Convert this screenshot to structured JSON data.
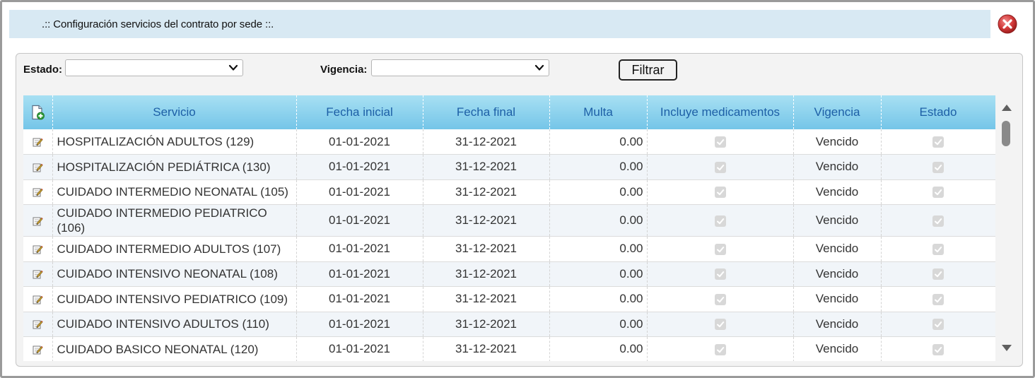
{
  "window": {
    "title": ".:: Configuración servicios del contrato por sede ::.",
    "close_icon": "close-circle-icon",
    "close_color": "#d33a3a"
  },
  "filters": {
    "estado_label": "Estado:",
    "estado_value": "",
    "vigencia_label": "Vigencia:",
    "vigencia_value": "",
    "filter_button": "Filtrar"
  },
  "table": {
    "add_icon": "add-document-icon",
    "columns": [
      "Servicio",
      "Fecha inicial",
      "Fecha final",
      "Multa",
      "Incluye medicamentos",
      "Vigencia",
      "Estado"
    ],
    "row_icon": "edit-icon",
    "rows": [
      {
        "servicio": "HOSPITALIZACIÓN ADULTOS (129)",
        "fecha_inicial": "01-01-2021",
        "fecha_final": "31-12-2021",
        "multa": "0.00",
        "incluye_medicamentos": true,
        "vigencia": "Vencido",
        "estado": true
      },
      {
        "servicio": "HOSPITALIZACIÓN PEDIÁTRICA (130)",
        "fecha_inicial": "01-01-2021",
        "fecha_final": "31-12-2021",
        "multa": "0.00",
        "incluye_medicamentos": true,
        "vigencia": "Vencido",
        "estado": true
      },
      {
        "servicio": "CUIDADO INTERMEDIO NEONATAL (105)",
        "fecha_inicial": "01-01-2021",
        "fecha_final": "31-12-2021",
        "multa": "0.00",
        "incluye_medicamentos": true,
        "vigencia": "Vencido",
        "estado": true
      },
      {
        "servicio": "CUIDADO INTERMEDIO PEDIATRICO (106)",
        "fecha_inicial": "01-01-2021",
        "fecha_final": "31-12-2021",
        "multa": "0.00",
        "incluye_medicamentos": true,
        "vigencia": "Vencido",
        "estado": true
      },
      {
        "servicio": "CUIDADO INTERMEDIO ADULTOS (107)",
        "fecha_inicial": "01-01-2021",
        "fecha_final": "31-12-2021",
        "multa": "0.00",
        "incluye_medicamentos": true,
        "vigencia": "Vencido",
        "estado": true
      },
      {
        "servicio": "CUIDADO INTENSIVO NEONATAL (108)",
        "fecha_inicial": "01-01-2021",
        "fecha_final": "31-12-2021",
        "multa": "0.00",
        "incluye_medicamentos": true,
        "vigencia": "Vencido",
        "estado": true
      },
      {
        "servicio": "CUIDADO INTENSIVO PEDIATRICO (109)",
        "fecha_inicial": "01-01-2021",
        "fecha_final": "31-12-2021",
        "multa": "0.00",
        "incluye_medicamentos": true,
        "vigencia": "Vencido",
        "estado": true
      },
      {
        "servicio": "CUIDADO INTENSIVO ADULTOS (110)",
        "fecha_inicial": "01-01-2021",
        "fecha_final": "31-12-2021",
        "multa": "0.00",
        "incluye_medicamentos": true,
        "vigencia": "Vencido",
        "estado": true
      },
      {
        "servicio": "CUIDADO BASICO NEONATAL (120)",
        "fecha_inicial": "01-01-2021",
        "fecha_final": "31-12-2021",
        "multa": "0.00",
        "incluye_medicamentos": true,
        "vigencia": "Vencido",
        "estado": true
      }
    ]
  },
  "colors": {
    "header_text": "#1d5fa6",
    "titlebar_bg": "#d8e9f3",
    "header_bg": "#8dd2ee"
  }
}
